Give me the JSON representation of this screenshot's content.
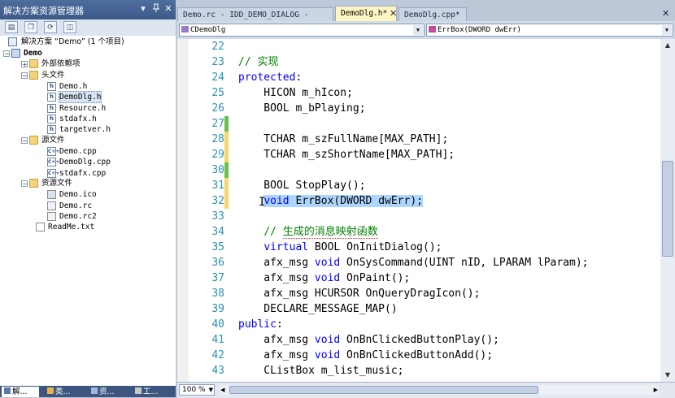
{
  "solution_explorer": {
    "title": "解决方案资源管理器",
    "title_buttons": [
      "▾",
      "📌",
      "✕"
    ],
    "toolbar_icons": [
      "properties-icon",
      "show-all-files-icon",
      "refresh-icon",
      "view-class-diagram-icon"
    ],
    "tree": [
      {
        "label": "解决方案 “Demo” (1 个项目)",
        "kind": "solution",
        "indent": 0
      },
      {
        "label": "Demo",
        "kind": "project",
        "indent": 1,
        "bold": true
      },
      {
        "label": "外部依赖项",
        "kind": "folder",
        "indent": 2,
        "collapsed": true
      },
      {
        "label": "头文件",
        "kind": "folder",
        "indent": 2
      },
      {
        "label": "Demo.h",
        "kind": "h",
        "indent": 3
      },
      {
        "label": "DemoDlg.h",
        "kind": "h",
        "indent": 3,
        "selected": true
      },
      {
        "label": "Resource.h",
        "kind": "h",
        "indent": 3
      },
      {
        "label": "stdafx.h",
        "kind": "h",
        "indent": 3
      },
      {
        "label": "targetver.h",
        "kind": "h",
        "indent": 3
      },
      {
        "label": "源文件",
        "kind": "folder",
        "indent": 2
      },
      {
        "label": "Demo.cpp",
        "kind": "cpp",
        "indent": 3
      },
      {
        "label": "DemoDlg.cpp",
        "kind": "cpp",
        "indent": 3
      },
      {
        "label": "stdafx.cpp",
        "kind": "cpp",
        "indent": 3
      },
      {
        "label": "资源文件",
        "kind": "folder",
        "indent": 2
      },
      {
        "label": "Demo.ico",
        "kind": "ico",
        "indent": 3
      },
      {
        "label": "Demo.rc",
        "kind": "rc",
        "indent": 3
      },
      {
        "label": "Demo.rc2",
        "kind": "rc",
        "indent": 3
      },
      {
        "label": "ReadMe.txt",
        "kind": "txt",
        "indent": 2
      }
    ],
    "bottom_tabs": [
      "解...",
      "类...",
      "资...",
      "工..."
    ]
  },
  "editor": {
    "tabs": [
      {
        "label": "Demo.rc - IDD_DEMO_DIALOG - Dialog",
        "active": false
      },
      {
        "label": "DemoDlg.h*",
        "active": true
      },
      {
        "label": "DemoDlg.cpp*",
        "active": false
      }
    ],
    "close_symbol": "✕",
    "class_combo": "CDemoDlg",
    "member_combo": "ErrBox(DWORD dwErr)",
    "zoom": "100 %",
    "lines": [
      {
        "n": "22",
        "text": ""
      },
      {
        "n": "23",
        "text": "// 实现"
      },
      {
        "n": "24",
        "text": "protected:"
      },
      {
        "n": "25",
        "text": "    HICON m_hIcon;"
      },
      {
        "n": "26",
        "text": "    BOOL m_bPlaying;"
      },
      {
        "n": "27",
        "text": ""
      },
      {
        "n": "28",
        "text": "    TCHAR m_szFullName[MAX_PATH];"
      },
      {
        "n": "29",
        "text": "    TCHAR m_szShortName[MAX_PATH];"
      },
      {
        "n": "30",
        "text": ""
      },
      {
        "n": "31",
        "text": "    BOOL StopPlay();"
      },
      {
        "n": "32",
        "text": "    void ErrBox(DWORD dwErr);"
      },
      {
        "n": "33",
        "text": ""
      },
      {
        "n": "34",
        "text": "    // 生成的消息映射函数"
      },
      {
        "n": "35",
        "text": "    virtual BOOL OnInitDialog();"
      },
      {
        "n": "36",
        "text": "    afx_msg void OnSysCommand(UINT nID, LPARAM lParam);"
      },
      {
        "n": "37",
        "text": "    afx_msg void OnPaint();"
      },
      {
        "n": "38",
        "text": "    afx_msg HCURSOR OnQueryDragIcon();"
      },
      {
        "n": "39",
        "text": "    DECLARE_MESSAGE_MAP()"
      },
      {
        "n": "40",
        "text": "public:"
      },
      {
        "n": "41",
        "text": "    afx_msg void OnBnClickedButtonPlay();"
      },
      {
        "n": "42",
        "text": "    afx_msg void OnBnClickedButtonAdd();"
      },
      {
        "n": "43",
        "text": "    CListBox m_list_music;"
      }
    ],
    "colors": {
      "keyword": "#0000FF",
      "comment": "#008000",
      "line_number": "#2B91AF",
      "selection": "#ADD6FF",
      "changed_saved": "#6CC04A",
      "changed_unsaved": "#F5D868"
    }
  }
}
